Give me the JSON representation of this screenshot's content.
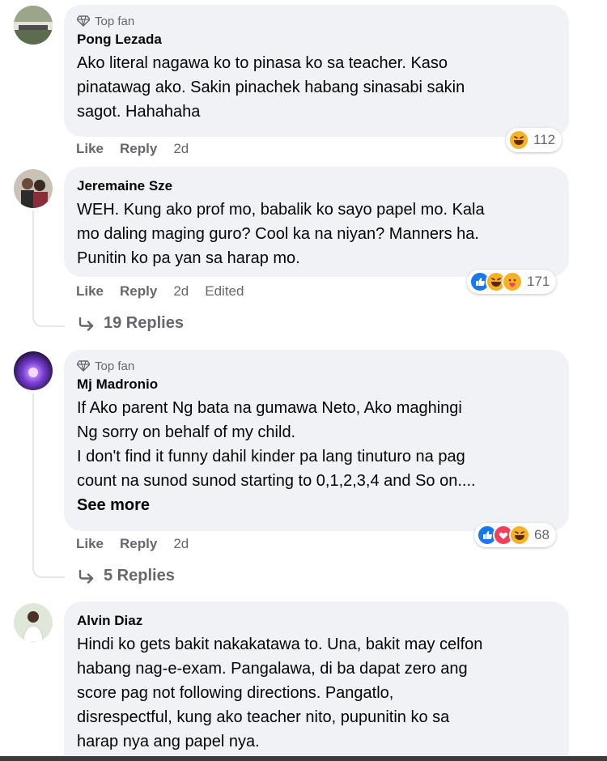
{
  "comments": [
    {
      "badge": "Top fan",
      "author": "Pong Lezada",
      "text": "Ako literal nagawa ko to pinasa ko sa teacher. Kaso\npinatawag ako. Sakin pinachek habang sinasabi sakin\nsagot. Hahahaha",
      "like": "Like",
      "reply": "Reply",
      "time": "2d",
      "reaction_count": "112",
      "reactions": [
        "haha-icon"
      ]
    },
    {
      "author": "Jeremaine Sze",
      "text": "WEH. Kung ako prof mo, babalik ko sayo papel mo. Kala\nmo daling maging guro? Cool ka na niyan? Manners ha.\nPunitin ko pa yan sa harap mo.",
      "like": "Like",
      "reply": "Reply",
      "time": "2d",
      "edited": "Edited",
      "reaction_count": "171",
      "reactions": [
        "like-icon",
        "haha-icon",
        "care-icon"
      ],
      "replies": "19 Replies"
    },
    {
      "badge": "Top fan",
      "author": "Mj Madronio",
      "text": "If Ako parent Ng bata na gumawa Neto, Ako maghingi\nNg sorry on behalf of my child.\nI don't find it funny dahil kinder pa lang tinuturo na pag\ncount na sunod sunod starting to 0,1,2,3,4 and So on....",
      "see_more": "See more",
      "like": "Like",
      "reply": "Reply",
      "time": "2d",
      "reaction_count": "68",
      "reactions": [
        "like-icon",
        "love-icon",
        "haha-icon"
      ],
      "replies": "5 Replies"
    },
    {
      "author": "Alvin Diaz",
      "text": "Hindi ko gets bakit nakakatawa to. Una, bakit may celfon\nhabang nag-e-exam. Pangalawa, di ba dapat zero ang\nscore pag not following directions. Pangatlo,\ndisrespectful, kung ako teacher nito, pupunitin ko sa\nharap nya ang papel nya."
    }
  ],
  "colors": {
    "bubble": "#f0f2f5",
    "secondary_text": "#65676b",
    "like_blue": "#1877f2",
    "love_red": "#f33e58",
    "haha_yellow": "#f7b125"
  }
}
